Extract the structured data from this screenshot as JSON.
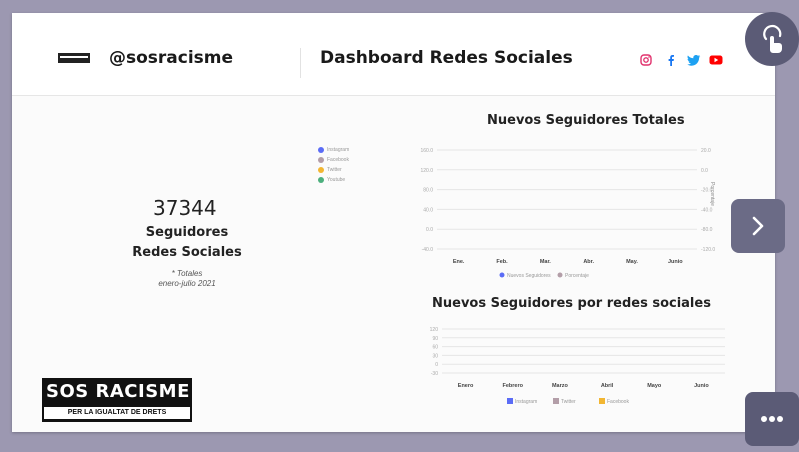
{
  "header": {
    "handle": "@sosracisme",
    "title": "Dashboard Redes Sociales"
  },
  "kpi": {
    "value": "37344",
    "line1": "Seguidores",
    "line2": "Redes Sociales",
    "note1": "* Totales",
    "note2": "enero-julio 2021"
  },
  "logo": {
    "line1": "SOS RACISME",
    "line2": "PER LA IGUALTAT DE DRETS"
  },
  "social_icons": [
    "instagram-icon",
    "facebook-icon",
    "twitter-icon",
    "youtube-icon"
  ],
  "colors": {
    "instagram": "#e1306c",
    "facebook": "#1877f2",
    "twitter": "#1da1f2",
    "youtube": "#ff0000",
    "series_blue": "#5b6cf6",
    "series_grey": "#b39ea8",
    "series_yellow": "#f2b632",
    "series_green": "#4caf7d"
  },
  "chart_data": [
    {
      "type": "line",
      "title": "Nuevos Seguidores Totales",
      "categories": [
        "Ene.",
        "Feb.",
        "Mar.",
        "Abr.",
        "May.",
        "Junio"
      ],
      "yticks_left": [
        "160.0",
        "120.0",
        "80.0",
        "40.0",
        "0.0",
        "-40.0"
      ],
      "yticks_right": [
        "20.0",
        "0.0",
        "-20.0",
        "-40.0",
        "-80.0",
        "-120.0"
      ],
      "ylabel_right": "Porcentaje",
      "legend_left": [
        "Instagram",
        "Facebook",
        "Twitter",
        "Youtube"
      ],
      "legend_bottom": [
        "Nuevos Seguidores",
        "Porcentaje"
      ],
      "grid": true
    },
    {
      "type": "bar",
      "title": "Nuevos Seguidores por redes sociales",
      "categories": [
        "Enero",
        "Febrero",
        "Marzo",
        "Abril",
        "Mayo",
        "Junio"
      ],
      "yticks": [
        "120",
        "90",
        "60",
        "30",
        "0",
        "-30"
      ],
      "series": [
        {
          "name": "Instagram",
          "values": [
            0,
            0,
            0,
            0,
            0,
            0
          ]
        },
        {
          "name": "Twitter",
          "values": [
            0,
            0,
            0,
            0,
            0,
            0
          ]
        },
        {
          "name": "Facebook",
          "values": [
            0,
            0,
            0,
            0,
            0,
            0
          ]
        }
      ],
      "grid": true
    }
  ]
}
